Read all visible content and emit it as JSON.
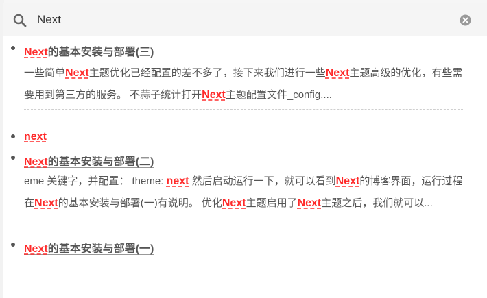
{
  "search": {
    "value": "Next",
    "placeholder": ""
  },
  "results": [
    {
      "title_parts": [
        {
          "t": "Next",
          "hl": true
        },
        {
          "t": "的基本安装与部署(三)",
          "hl": false
        }
      ],
      "excerpt_parts": [
        {
          "t": "一些简单",
          "hl": false
        },
        {
          "t": "Next",
          "hl": true
        },
        {
          "t": "主题优化已经配置的差不多了，接下来我们进行一些",
          "hl": false
        },
        {
          "t": "Next",
          "hl": true
        },
        {
          "t": "主题高级的优化，有些需要用到第三方的服务。 不蒜子统计打开",
          "hl": false
        },
        {
          "t": "Next",
          "hl": true
        },
        {
          "t": "主题配置文件_config....",
          "hl": false
        }
      ]
    },
    {
      "title_parts": [
        {
          "t": "next",
          "hl": true
        }
      ],
      "excerpt_parts": []
    },
    {
      "title_parts": [
        {
          "t": "Next",
          "hl": true
        },
        {
          "t": "的基本安装与部署(二)",
          "hl": false
        }
      ],
      "excerpt_parts": [
        {
          "t": "eme 关键字，并配置： theme: ",
          "hl": false
        },
        {
          "t": "next",
          "hl": true
        },
        {
          "t": " 然后启动运行一下，就可以看到",
          "hl": false
        },
        {
          "t": "Next",
          "hl": true
        },
        {
          "t": "的博客界面，运行过程在",
          "hl": false
        },
        {
          "t": "Next",
          "hl": true
        },
        {
          "t": "的基本安装与部署(一)有说明。 优化",
          "hl": false
        },
        {
          "t": "Next",
          "hl": true
        },
        {
          "t": "主题启用了",
          "hl": false
        },
        {
          "t": "Next",
          "hl": true
        },
        {
          "t": "主题之后，我们就可以...",
          "hl": false
        }
      ]
    },
    {
      "title_parts": [
        {
          "t": "Next",
          "hl": true
        },
        {
          "t": "的基本安装与部署(一)",
          "hl": false
        }
      ],
      "excerpt_parts": []
    }
  ],
  "colors": {
    "highlight": "#ff2a2a",
    "text": "#555555",
    "search_bg": "#f5f5f5"
  },
  "icons": {
    "search": "search-icon",
    "clear": "close-icon"
  }
}
